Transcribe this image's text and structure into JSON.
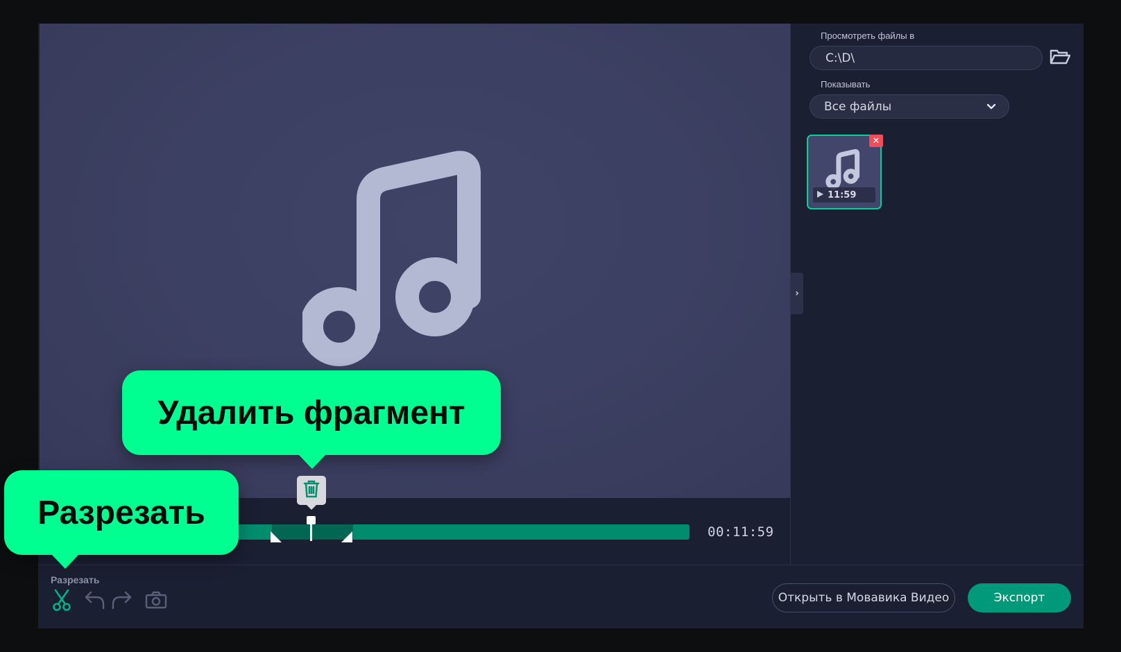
{
  "sidebar": {
    "browse_label": "Просмотреть файлы в",
    "path_value": "C:\\D\\",
    "show_label": "Показывать",
    "filter_value": "Все файлы",
    "thumbnail": {
      "duration": "11:59"
    }
  },
  "timeline": {
    "total_time": "00:11:59"
  },
  "toolbar": {
    "cut_label": "Разрезать"
  },
  "footer": {
    "open_button": "Открыть в Мовавика Видео",
    "export_button": "Экспорт"
  },
  "callouts": {
    "delete_fragment": "Удалить фрагмент",
    "cut": "Разрезать"
  },
  "colors": {
    "accent": "#00ff91",
    "timeline": "#008d6e",
    "export": "#00997a",
    "close": "#f04c5a"
  },
  "icons": [
    "music-note-icon",
    "trash-icon",
    "scissors-icon",
    "undo-icon",
    "redo-icon",
    "camera-icon",
    "folder-icon",
    "chevron-down-icon",
    "play-icon",
    "close-icon",
    "chevron-right-icon"
  ]
}
